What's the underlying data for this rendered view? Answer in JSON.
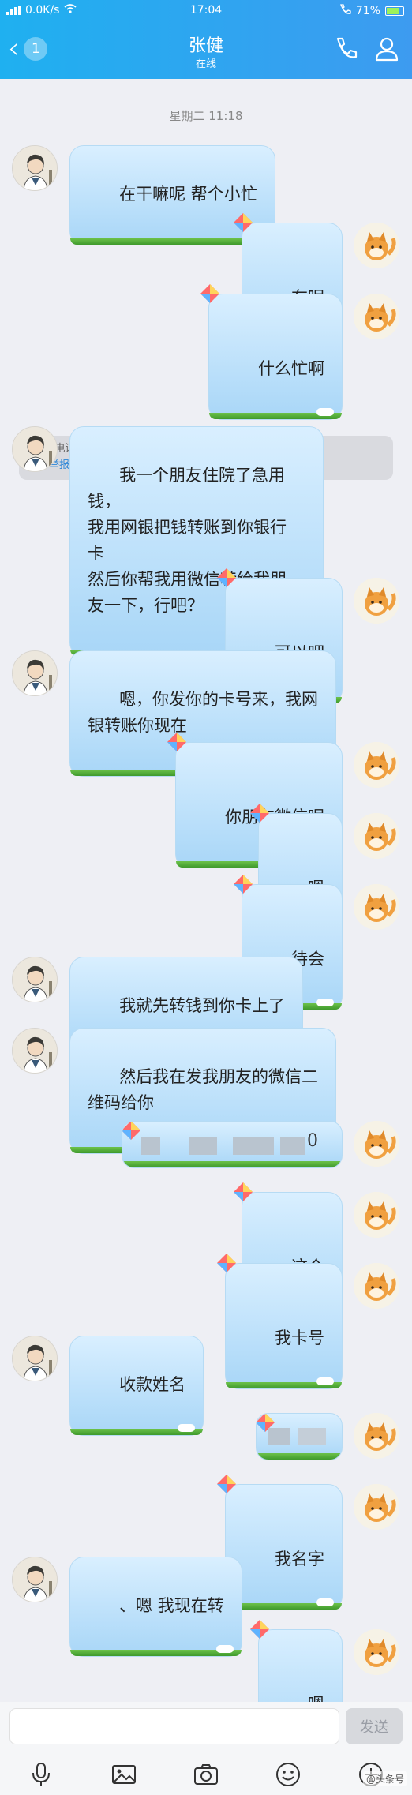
{
  "status_bar": {
    "network": "0.0K/s",
    "time": "17:04",
    "battery": "71%"
  },
  "header": {
    "back_badge": "1",
    "title": "张健",
    "subtitle": "在线"
  },
  "chat": {
    "timestamp": "星期二 11:18",
    "notice": {
      "text": "请QQ电话核实好友身份，涉及钱财务必警惕。发现异常？",
      "link": "立即举报"
    },
    "messages": [
      {
        "from": "friend",
        "text": "在干嘛呢 帮个小忙"
      },
      {
        "from": "self",
        "text": "在呢"
      },
      {
        "from": "self",
        "text": "什么忙啊"
      },
      {
        "from": "friend",
        "text": "我一个朋友住院了急用钱，\n我用网银把钱转账到你银行\n卡\n然后你帮我用微信转给我朋\n友一下，行吧？"
      },
      {
        "from": "self",
        "text": "可以吧"
      },
      {
        "from": "friend",
        "text": "嗯，你发你的卡号来，我网\n银转账你现在"
      },
      {
        "from": "self",
        "text": "你朋友微信呢"
      },
      {
        "from": "self",
        "text": "嗯"
      },
      {
        "from": "self",
        "text": "待会"
      },
      {
        "from": "friend",
        "text": "我就先转钱到你卡上了"
      },
      {
        "from": "friend",
        "text": "然后我在发我朋友的微信二\n维码给你"
      },
      {
        "from": "self",
        "text": "0"
      },
      {
        "from": "self",
        "text": "这个"
      },
      {
        "from": "self",
        "text": "我卡号"
      },
      {
        "from": "friend",
        "text": "收款姓名"
      },
      {
        "from": "self",
        "text": ""
      },
      {
        "from": "self",
        "text": "我名字"
      },
      {
        "from": "friend",
        "text": "、嗯 我现在转"
      },
      {
        "from": "self",
        "text": "嗯"
      }
    ]
  },
  "input": {
    "placeholder": "",
    "send_label": "发送"
  },
  "toolbar": {
    "icons": [
      "microphone-icon",
      "image-icon",
      "camera-icon",
      "emoji-icon",
      "plus-icon"
    ]
  },
  "watermark": "@头条号"
}
